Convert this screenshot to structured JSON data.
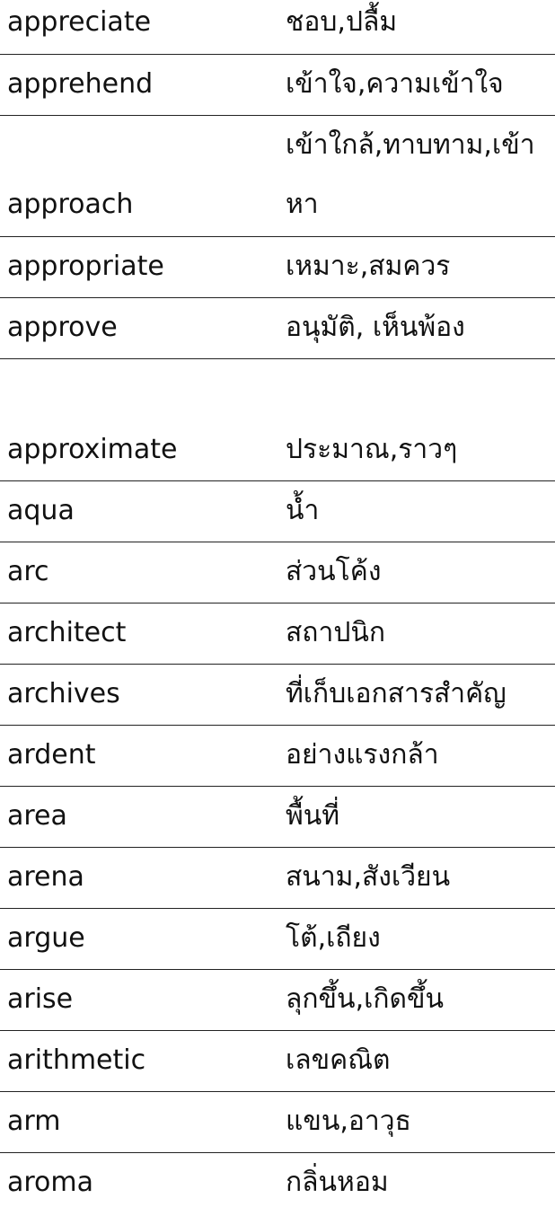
{
  "entries": [
    {
      "word": "appreciate",
      "meaning": "ชอบ,ปลื้ม"
    },
    {
      "word": "apprehend",
      "meaning": "เข้าใจ,ความเข้าใจ"
    },
    {
      "word": "approach",
      "meaning_line1": "เข้าใกล้,ทาบทาม,เข้า",
      "meaning_line2": "หา"
    },
    {
      "word": "appropriate",
      "meaning": "เหมาะ,สมควร"
    },
    {
      "word": "approve",
      "meaning": "อนุมัติ, เห็นพ้อง"
    },
    {
      "word": "approximate",
      "meaning": "ประมาณ,ราวๆ"
    },
    {
      "word": "aqua",
      "meaning": "น้ำ"
    },
    {
      "word": "arc",
      "meaning": "ส่วนโค้ง"
    },
    {
      "word": "architect",
      "meaning": "สถาปนิก"
    },
    {
      "word": "archives",
      "meaning": "ที่เก็บเอกสารสำคัญ"
    },
    {
      "word": "ardent",
      "meaning": "อย่างแรงกล้า"
    },
    {
      "word": "area",
      "meaning": "พื้นที่"
    },
    {
      "word": "arena",
      "meaning": "สนาม,สังเวียน"
    },
    {
      "word": "argue",
      "meaning": "โต้,เถียง"
    },
    {
      "word": "arise",
      "meaning": "ลุกขึ้น,เกิดขึ้น"
    },
    {
      "word": "arithmetic",
      "meaning": "เลขคณิต"
    },
    {
      "word": "arm",
      "meaning": "แขน,อาวุธ"
    },
    {
      "word": "aroma",
      "meaning": "กลิ่นหอม"
    }
  ]
}
